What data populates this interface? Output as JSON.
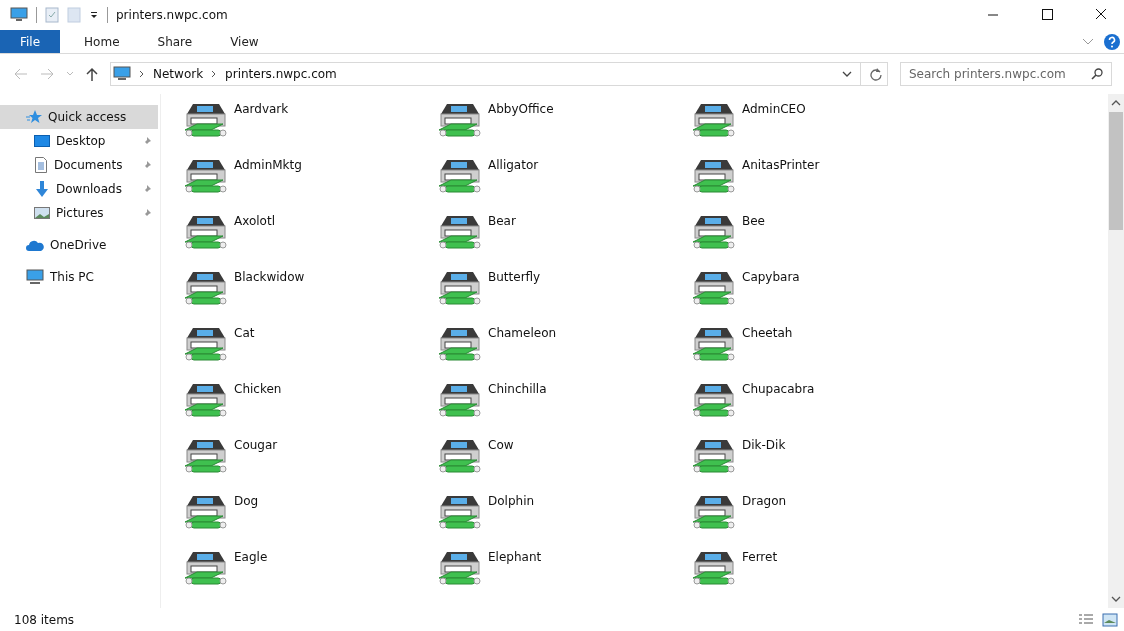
{
  "window": {
    "title": "printers.nwpc.com"
  },
  "ribbon_tabs": [
    {
      "label": "File",
      "selected": true
    },
    {
      "label": "Home",
      "selected": false
    },
    {
      "label": "Share",
      "selected": false
    },
    {
      "label": "View",
      "selected": false
    }
  ],
  "address": {
    "path": [
      "Network",
      "printers.nwpc.com"
    ]
  },
  "search": {
    "placeholder": "Search printers.nwpc.com"
  },
  "sidebar": {
    "items": [
      {
        "label": "Quick access",
        "kind": "star",
        "selected": true,
        "children": [
          {
            "label": "Desktop",
            "kind": "desktop",
            "selected": false,
            "pinned": true
          },
          {
            "label": "Documents",
            "kind": "document",
            "selected": false,
            "pinned": true
          },
          {
            "label": "Downloads",
            "kind": "download",
            "selected": false,
            "pinned": true
          },
          {
            "label": "Pictures",
            "kind": "picture",
            "selected": false,
            "pinned": true
          }
        ]
      },
      {
        "label": "OneDrive",
        "kind": "cloud",
        "selected": false
      },
      {
        "label": "This PC",
        "kind": "computer",
        "selected": false
      }
    ]
  },
  "printers": [
    "Aardvark",
    "AbbyOffice",
    "AdminCEO",
    "AdminMktg",
    "Alligator",
    "AnitasPrinter",
    "Axolotl",
    "Bear",
    "Bee",
    "Blackwidow",
    "Butterfly",
    "Capybara",
    "Cat",
    "Chameleon",
    "Cheetah",
    "Chicken",
    "Chinchilla",
    "Chupacabra",
    "Cougar",
    "Cow",
    "Dik-Dik",
    "Dog",
    "Dolphin",
    "Dragon",
    "Eagle",
    "Elephant",
    "Ferret"
  ],
  "status_bar": {
    "count": "108 items"
  }
}
